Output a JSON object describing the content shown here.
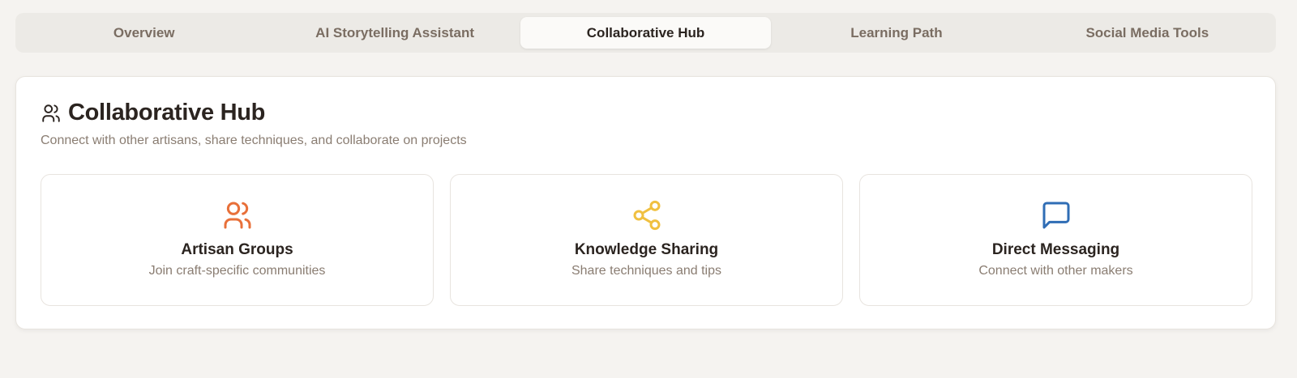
{
  "tabs": [
    {
      "label": "Overview",
      "active": false
    },
    {
      "label": "AI Storytelling Assistant",
      "active": false
    },
    {
      "label": "Collaborative Hub",
      "active": true
    },
    {
      "label": "Learning Path",
      "active": false
    },
    {
      "label": "Social Media Tools",
      "active": false
    }
  ],
  "panel": {
    "icon": "users-icon",
    "title": "Collaborative Hub",
    "subtitle": "Connect with other artisans, share techniques, and collaborate on projects"
  },
  "cards": [
    {
      "icon": "users-icon",
      "icon_color": "#e8703a",
      "title": "Artisan Groups",
      "description": "Join craft-specific communities"
    },
    {
      "icon": "share-icon",
      "icon_color": "#f0c040",
      "title": "Knowledge Sharing",
      "description": "Share techniques and tips"
    },
    {
      "icon": "message-square-icon",
      "icon_color": "#2f6db5",
      "title": "Direct Messaging",
      "description": "Connect with other makers"
    }
  ],
  "colors": {
    "background": "#f5f3f0",
    "text_primary": "#2b2420",
    "text_muted": "#8a7d72"
  }
}
